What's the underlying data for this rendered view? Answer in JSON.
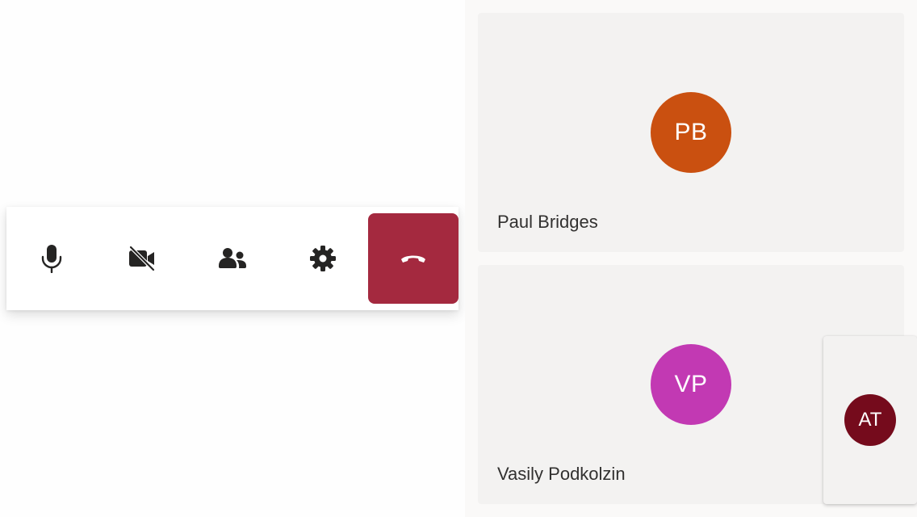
{
  "controls": {
    "buttons": [
      {
        "name": "microphone",
        "icon": "microphone-icon"
      },
      {
        "name": "camera",
        "icon": "video-off-icon"
      },
      {
        "name": "participants",
        "icon": "people-icon"
      },
      {
        "name": "settings",
        "icon": "gear-icon"
      },
      {
        "name": "end-call",
        "icon": "hang-up-icon"
      }
    ],
    "end_call_color": "#a4293f"
  },
  "participants": [
    {
      "initials": "PB",
      "name": "Paul Bridges",
      "color": "#ca5010"
    },
    {
      "initials": "VP",
      "name": "Vasily Podkolzin",
      "color": "#c239b3"
    }
  ],
  "self": {
    "initials": "AT",
    "color": "#750b1c"
  }
}
